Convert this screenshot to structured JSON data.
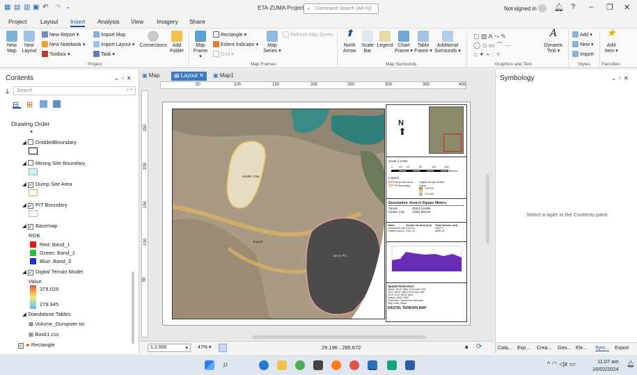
{
  "titlebar": {
    "title": "ETA-ZUMA Project",
    "search_placeholder": "Command Search (Alt+Q)",
    "user": "Not signed in",
    "help": "?"
  },
  "tabs": [
    "Project",
    "Layout",
    "Insert",
    "Analysis",
    "View",
    "Imagery",
    "Share"
  ],
  "ribbon": {
    "project": {
      "new_map": "New Map",
      "new_layout": "New Layout",
      "new_report": "New Report",
      "new_notebook": "New Notebook",
      "toolbox": "Toolbox",
      "import_map": "Import Map",
      "import_layout": "Import Layout",
      "task": "Task",
      "connections": "Connections",
      "add_folder": "Add Folder",
      "group": "Project"
    },
    "map_frames": {
      "map_frame": "Map Frame",
      "rectangle": "Rectangle",
      "extent_indicator": "Extent Indicator",
      "grid": "Grid",
      "refresh": "Refresh Map Series",
      "map_series": "Map Series",
      "group": "Map Frames"
    },
    "surrounds": {
      "north_arrow": "North Arrow",
      "scale_bar": "Scale Bar",
      "legend": "Legend",
      "chart_frame": "Chart Frame",
      "table_frame": "Table Frame",
      "additional": "Additional Surrounds",
      "group": "Map Surrounds"
    },
    "graphics": {
      "dynamic_text": "Dynamic Text",
      "group": "Graphics and Text"
    },
    "styles": {
      "add": "Add",
      "new": "New",
      "import": "Import",
      "group": "Styles"
    },
    "favorites": {
      "add_item": "Add Item",
      "group": "Favorites"
    }
  },
  "contents": {
    "title": "Contents",
    "search_placeholder": "Search",
    "drawing_order": "Drawing Order",
    "layers": [
      {
        "name": "GriddedBoundary",
        "checked": false
      },
      {
        "name": "Mining Site Boundary",
        "checked": false
      },
      {
        "name": "Dump Site Area",
        "checked": true
      },
      {
        "name": "PIT Boundary",
        "checked": true
      },
      {
        "name": "Basemap",
        "checked": true
      },
      {
        "name": "Digital Terrain Model",
        "checked": true
      }
    ],
    "rgb": "RGB",
    "bands": [
      "Red:  Band_1",
      "Green: Band_2",
      "Blue:  Band_3"
    ],
    "value": "Value",
    "value_high": "378.028",
    "value_low": "279.945",
    "standalone": "Standalone Tables",
    "tables": [
      "Volume_Dumpsite.txt",
      "Book1.csv"
    ],
    "rectangle": "Rectangle"
  },
  "mapview": {
    "tabs": [
      "Map",
      "Layout",
      "Map1"
    ],
    "ruler_top": [
      "50",
      "100",
      "150",
      "200",
      "250",
      "300",
      "350",
      "400"
    ],
    "ruler_left": [
      "250",
      "200",
      "150",
      "100",
      "50"
    ],
    "map_labels": {
      "kaolitic": "Kaolitic Clay",
      "topsoil": "Topsoil",
      "vanzo": "Vanzo Pit"
    },
    "side": {
      "north": "N",
      "scale": "Scale 1:2,000",
      "scale_ticks": [
        "0",
        "20",
        "40",
        "80",
        "120",
        "160"
      ],
      "scale_unit": "Meters",
      "legend": "Legend",
      "legend_items": [
        "Dump Site Area",
        "PIT Boundary"
      ],
      "dtm": "Digital Terrain Model",
      "dtm_value": "Value",
      "dtm_high": "378.028",
      "dtm_low": "279.945",
      "table1_header": [
        "Description",
        "Area in Square Meters"
      ],
      "table1_rows": [
        [
          "Topsoil",
          "35321.110396"
        ],
        [
          "Kaolitic Clay",
          "12592.600119"
        ]
      ],
      "table2_header": [
        "Name",
        "Terrain 3D Area  (m2)",
        "Total Volume  (m3)"
      ],
      "table2_rows": [
        [
          "Unrecycled soil",
          "2320.91",
          "4537.9"
        ],
        [
          "Graded topsoil",
          "2321.11",
          "4896.15"
        ]
      ],
      "spatial_title": "Spatial Reference",
      "spatial_lines": [
        "Name: WGS 1984 UTM Zone 32N",
        "PCS: WGS 1984 UTM Zone 32N",
        "GCS: GCS WGS 1984",
        "Datum: WGS 1984",
        "Projection: Transverse Mercator",
        "Map Units: Meter"
      ],
      "map_title": "DIGITAL TERRAIN MAP"
    },
    "status": {
      "scale": "1:2,000",
      "zoom": "47%",
      "coords": "29.196 , 285.672"
    }
  },
  "symbology": {
    "title": "Symbology",
    "message": "Select a layer in the Contents pane.",
    "bottom_tabs": [
      "Cata...",
      "Exp...",
      "Crea...",
      "Geo...",
      "Ele...",
      "Sym...",
      "Export"
    ]
  },
  "taskbar": {
    "time": "11:07 am",
    "date": "16/02/2024"
  },
  "colors": {
    "accent": "#1a4f9c",
    "dump_site": "#f1d98a",
    "pit": "#e8a6a6",
    "red": "#e21b1b",
    "green": "#2cbf3a",
    "blue": "#1f2fd6"
  }
}
